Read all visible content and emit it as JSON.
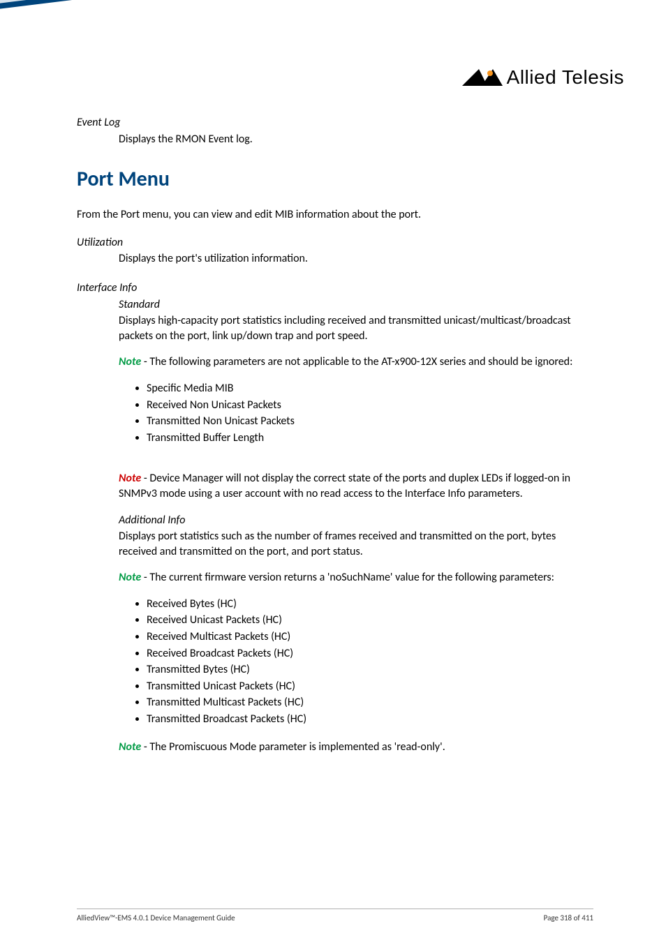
{
  "logo": {
    "brand": "Allied Telesis"
  },
  "eventLog": {
    "term": "Event Log",
    "def": "Displays the RMON Event log."
  },
  "section": {
    "title": "Port Menu"
  },
  "intro": "From the Port menu, you can view and edit MIB information about the port.",
  "utilization": {
    "term": "Utilization",
    "def": "Displays the port's utilization information."
  },
  "interfaceInfo": {
    "term": "Interface Info",
    "standard": {
      "term": "Standard",
      "def": "Displays high-capacity port statistics including received and transmitted unicast/multicast/broadcast packets on the port, link up/down trap and port speed.",
      "note1_label": "Note",
      "note1_text": " - The following parameters are not applicable to the AT-x900-12X series and should be ignored:",
      "note1_items": [
        "Specific Media MIB",
        "Received Non Unicast Packets",
        "Transmitted Non Unicast Packets",
        "Transmitted Buffer Length"
      ],
      "note2_label": "Note",
      "note2_text": " - Device Manager will not display the correct state of the ports and duplex LEDs if logged-on in SNMPv3 mode using a user account with no read access to the Interface Info parameters."
    },
    "additional": {
      "term": "Additional Info",
      "def": "Displays port statistics such as the number of frames received and transmitted on the port, bytes received and transmitted on the port, and port status.",
      "note1_label": "Note",
      "note1_text": " - The current firmware version returns a 'noSuchName' value for the following parameters:",
      "note1_items": [
        "Received Bytes (HC)",
        "Received Unicast Packets (HC)",
        "Received Multicast Packets (HC)",
        "Received Broadcast Packets (HC)",
        "Transmitted Bytes (HC)",
        "Transmitted Unicast Packets (HC)",
        "Transmitted Multicast Packets (HC)",
        "Transmitted Broadcast Packets (HC)"
      ],
      "note2_label": "Note",
      "note2_text": " - The Promiscuous Mode parameter is implemented as 'read-only'."
    }
  },
  "footer": {
    "left": "AlliedView™-EMS 4.0.1 Device Management Guide",
    "right": "Page 318 of 411"
  }
}
